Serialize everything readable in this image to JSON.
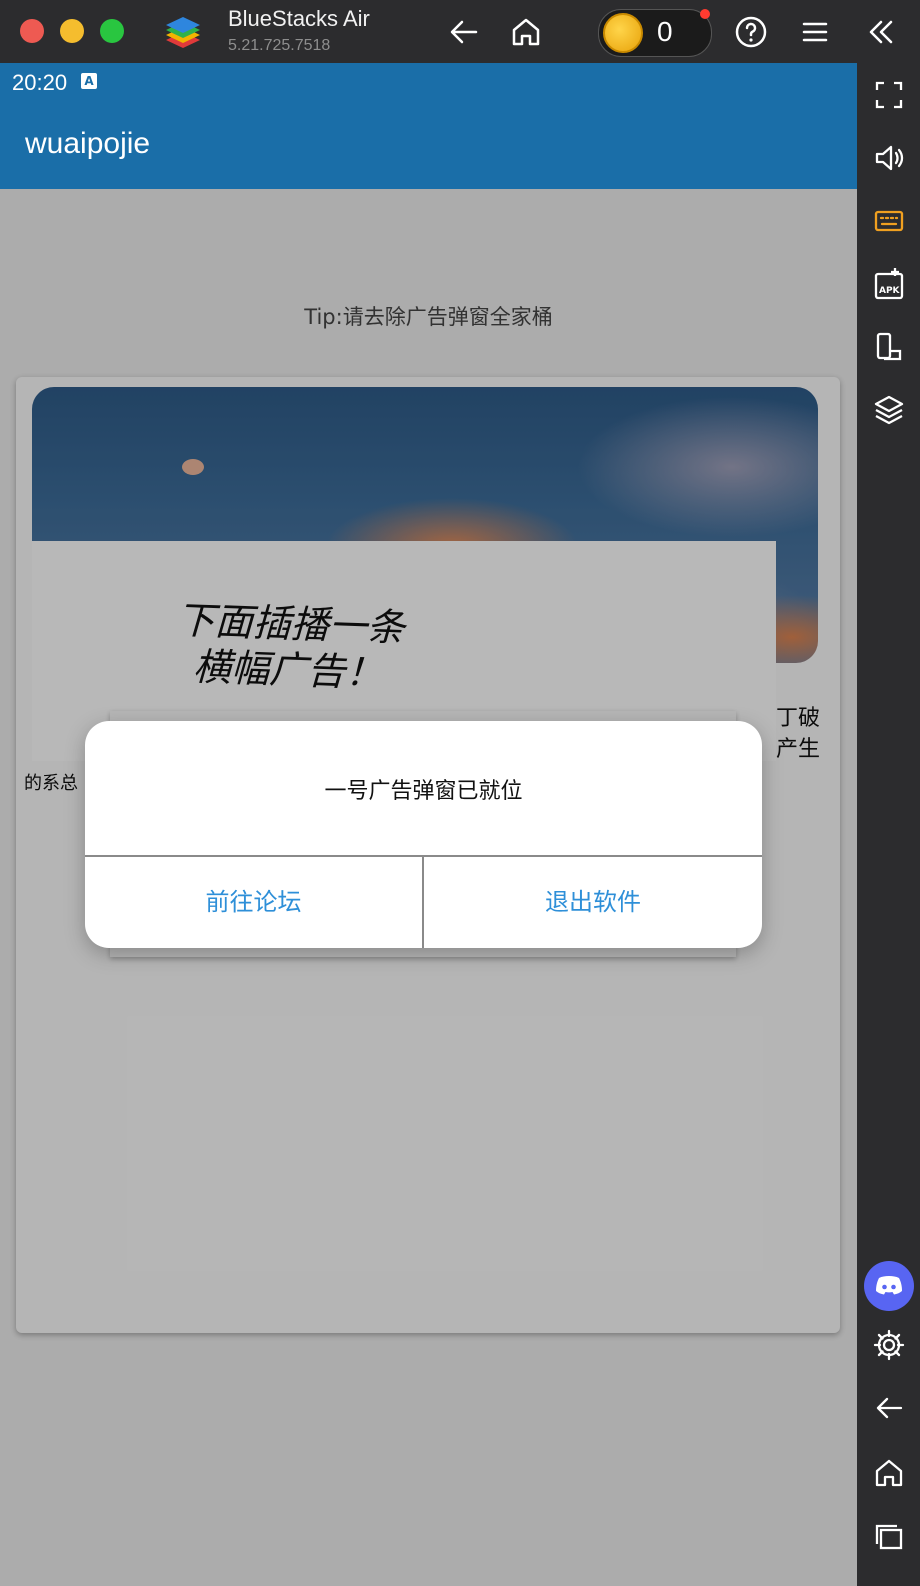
{
  "window": {
    "app_name": "BlueStacks Air",
    "version": "5.21.725.7518",
    "coin_count": "0"
  },
  "android": {
    "status_time": "20:20",
    "status_icon_letter": "A",
    "app_title": "wuaipojie",
    "tip": "Tip:请去除广告弹窗全家桶",
    "handwritten_line1": "下面插播一条",
    "handwritten_line2": "横幅广告！",
    "partial_right_line1": "丁破",
    "partial_right_line2": "产生",
    "partial_left": "的系总"
  },
  "dialog": {
    "message": "一号广告弹窗已就位",
    "left_button": "前往论坛",
    "right_button": "退出软件"
  },
  "colors": {
    "app_bar": "#1a6ea8",
    "dialog_button_text": "#2e8fd8",
    "discord": "#5865f2"
  }
}
